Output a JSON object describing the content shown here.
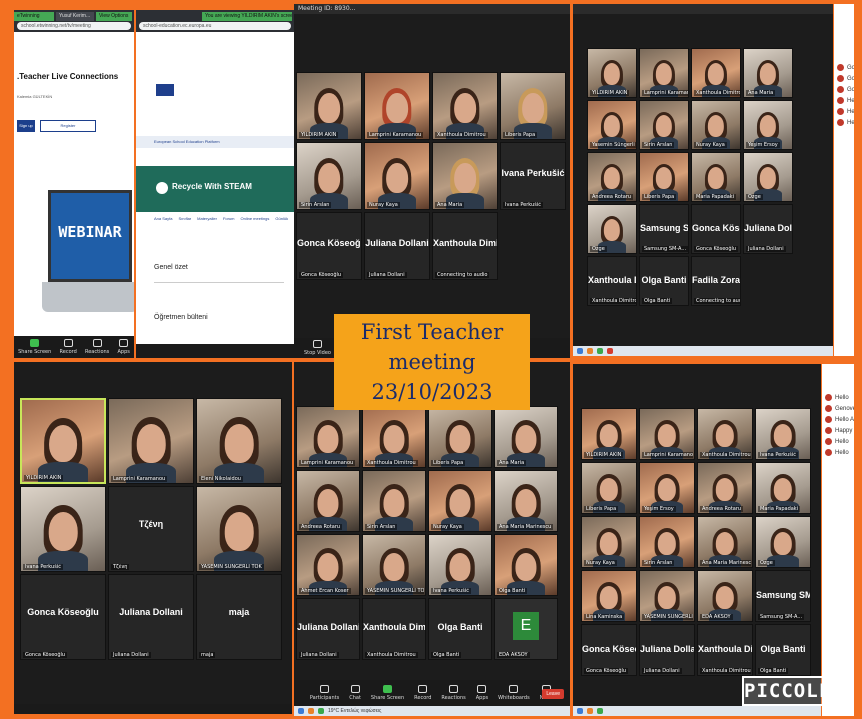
{
  "banner": {
    "line1": "First Teacher meeting",
    "line2": "23/10/2023"
  },
  "stamp": {
    "text": "PICCOLLA"
  },
  "panel_browser": {
    "tabs": [
      "eTwinning",
      "Yusuf Kerim...",
      "Sensoreic Sil..."
    ],
    "view_options": "View Options",
    "sharing_banner": "You are viewing YILDIRIM AKIN's screen",
    "url": "school.etwinning.net/tv/meeting",
    "page_heading": ".Teacher Live Connections",
    "organiser": "Kalemia GÜLTEKİN",
    "btn_primary": "Sign up",
    "btn_secondary": "Register",
    "webinar_word": "WEBINAR"
  },
  "panel_esep": {
    "url": "school-education.ec.europa.eu",
    "platform": "European School Education Platform",
    "project_title": "Recycle With STEAM",
    "nav": [
      "Ana Sayfa",
      "Sınıflar",
      "Materyaller",
      "Forum",
      "Online meetings",
      "Günlük",
      "Üyeler"
    ],
    "section1": "Genel özet",
    "section2": "Öğretmen bülteni"
  },
  "toolbar_labels": {
    "share": "Share Screen",
    "record": "Record",
    "reactions": "Reactions",
    "apps": "Apps",
    "whiteboards": "Whiteboards",
    "participants": "Participants",
    "chat": "Chat",
    "more": "More",
    "notes": "Notes",
    "leave": "Leave",
    "stop": "Stop Video"
  },
  "panel_zoom1": {
    "title": "Meeting ID: 8930...",
    "tiles": [
      {
        "name": "YILDIRIM AKIN",
        "style": "video",
        "hair": ""
      },
      {
        "name": "Lamprini Karamanou",
        "style": "video alt2",
        "hair": "red"
      },
      {
        "name": "Xanthoula Dimitrou",
        "style": "video",
        "hair": ""
      },
      {
        "name": "Liberis Papa",
        "style": "video alt1",
        "hair": "blond"
      },
      {
        "name": "Sirin Arslan",
        "style": "video alt3",
        "hair": ""
      },
      {
        "name": "Nuray Kaya",
        "style": "video alt2",
        "hair": ""
      },
      {
        "name": "Ana Maria",
        "style": "video",
        "hair": "blond"
      },
      {
        "name": "Ivana Perkušić",
        "style": "namecard",
        "big": "Ivana Perkušić"
      },
      {
        "name": "Gonca Köseoğlu",
        "style": "namecard",
        "big": "Gonca Köseoğlu"
      },
      {
        "name": "Juliana Dollani",
        "style": "namecard",
        "big": "Juliana Dollani"
      },
      {
        "name": "Connecting to audio",
        "style": "namecard",
        "big": "Xanthoula Dimit..."
      }
    ]
  },
  "panel_zoom2": {
    "tiles": [
      {
        "name": "YILDIRIM AKIN",
        "style": "video alt1"
      },
      {
        "name": "Lamprini Karamanou",
        "style": "video"
      },
      {
        "name": "Xanthoula Dimitrou",
        "style": "video alt2"
      },
      {
        "name": "Ana Maria",
        "style": "video alt3"
      },
      {
        "name": "Yasemin Süngerli",
        "style": "video alt2"
      },
      {
        "name": "Sirin Arslan",
        "style": "video"
      },
      {
        "name": "Nuray Kaya",
        "style": "video alt1"
      },
      {
        "name": "Yeşim Ersoy",
        "style": "video alt3"
      },
      {
        "name": "Andreea Rotaru",
        "style": "video"
      },
      {
        "name": "Liberis Papa",
        "style": "video alt2"
      },
      {
        "name": "Maria Papadaki",
        "style": "video alt1"
      },
      {
        "name": "Özge",
        "style": "video alt3"
      },
      {
        "name": "Özge",
        "style": "video alt3"
      },
      {
        "name": "Samsung SM-A...",
        "style": "namecard",
        "big": "Samsung SM-A..."
      },
      {
        "name": "Gonca Köseoğlu",
        "style": "namecard",
        "big": "Gonca Köseoğlu"
      },
      {
        "name": "Juliana Dollani",
        "style": "namecard",
        "big": "Juliana Dollani"
      },
      {
        "name": "Xanthoula Dimitrou",
        "style": "namecard",
        "big": "Xanthoula Dimi..."
      },
      {
        "name": "Olga Banti",
        "style": "namecard",
        "big": "Olga Banti"
      },
      {
        "name": "Connecting to audio",
        "style": "namecard",
        "big": "Fadila Zoranić"
      }
    ]
  },
  "panel_zoom3": {
    "tiles": [
      {
        "name": "YILDIRIM AKIN",
        "style": "video alt2",
        "active": true
      },
      {
        "name": "Lamprini Karamanou",
        "style": "video"
      },
      {
        "name": "Eleni Nikolaidou",
        "style": "video alt1"
      },
      {
        "name": "Ivana Perkušić",
        "style": "video alt3"
      },
      {
        "name": "Τζένη",
        "style": "namecard",
        "big": "Τζένη"
      },
      {
        "name": "YASEMİN SÜNGERLİ TOK",
        "style": "video alt1"
      },
      {
        "name": "Gonca Köseoğlu",
        "style": "namecard",
        "big": "Gonca Köseoğlu"
      },
      {
        "name": "Juliana Dollani",
        "style": "namecard",
        "big": "Juliana Dollani"
      },
      {
        "name": "maja",
        "style": "namecard",
        "big": "maja"
      }
    ]
  },
  "panel_zoom4": {
    "tiles": [
      {
        "name": "Lamprini Karamanou",
        "style": "video"
      },
      {
        "name": "Xanthoula Dimitrou",
        "style": "video alt2"
      },
      {
        "name": "Liberis Papa",
        "style": "video alt1"
      },
      {
        "name": "Ana Maria",
        "style": "video alt3"
      },
      {
        "name": "Andreea Rotaru",
        "style": "video alt1"
      },
      {
        "name": "Sirin Arslan",
        "style": "video"
      },
      {
        "name": "Nuray Kaya",
        "style": "video alt2"
      },
      {
        "name": "Ana Maria Marinescu",
        "style": "video alt3"
      },
      {
        "name": "Ahmet Ercan Koser",
        "style": "video"
      },
      {
        "name": "YASEMİN SÜNGERLİ TOK",
        "style": "video alt1"
      },
      {
        "name": "Ivana Perkušić",
        "style": "video alt3"
      },
      {
        "name": "Olga Banti",
        "style": "video alt2"
      },
      {
        "name": "Juliana Dollani",
        "style": "namecard",
        "big": "Juliana Dollani"
      },
      {
        "name": "Xanthoula Dimitrou",
        "style": "namecard",
        "big": "Xanthoula Dimi..."
      },
      {
        "name": "Olga Banti",
        "style": "namecard",
        "big": "Olga Banti"
      },
      {
        "name": "EDA AKSOY",
        "style": "avatar",
        "letter": "E"
      }
    ]
  },
  "panel_zoom5": {
    "tiles": [
      {
        "name": "YILDIRIM AKIN",
        "style": "video alt2"
      },
      {
        "name": "Lamprini Karamanou",
        "style": "video"
      },
      {
        "name": "Xanthoula Dimitrou",
        "style": "video alt1"
      },
      {
        "name": "Ivana Perkušić",
        "style": "video alt3"
      },
      {
        "name": "Liberis Papa",
        "style": "video alt1"
      },
      {
        "name": "Yeşim Ersoy",
        "style": "video alt2"
      },
      {
        "name": "Andreea Rotaru",
        "style": "video"
      },
      {
        "name": "Maria Papadaki",
        "style": "video alt3"
      },
      {
        "name": "Nuray Kaya",
        "style": "video"
      },
      {
        "name": "Sirin Arslan",
        "style": "video alt2"
      },
      {
        "name": "Ana Maria Marinescu",
        "style": "video alt1"
      },
      {
        "name": "Özge",
        "style": "video alt3"
      },
      {
        "name": "Lina Kaminska",
        "style": "video alt2"
      },
      {
        "name": "YASEMİN SÜNGERLİ TOK",
        "style": "video"
      },
      {
        "name": "EDA AKSOY",
        "style": "video alt1"
      },
      {
        "name": "Samsung SM-A...",
        "style": "namecard",
        "big": "Samsung SM-A..."
      },
      {
        "name": "Gonca Köseoğlu",
        "style": "namecard",
        "big": "Gonca Köseoğlu"
      },
      {
        "name": "Juliana Dollani",
        "style": "namecard",
        "big": "Juliana Dollani"
      },
      {
        "name": "Xanthoula Dimitrou",
        "style": "namecard",
        "big": "Xanthoula Dimi..."
      },
      {
        "name": "Olga Banti",
        "style": "namecard",
        "big": "Olga Banti"
      }
    ]
  },
  "chat": {
    "top": [
      "Go",
      "Go",
      "Go",
      "He",
      "He",
      "He"
    ],
    "bottom": [
      "Hello",
      "Genovev again",
      "Hello Ar excited",
      "Happy Kalemi",
      "Hello",
      "Hello"
    ]
  },
  "taskbar": {
    "weather": "19°C Εντελώς νεφώσεις"
  }
}
